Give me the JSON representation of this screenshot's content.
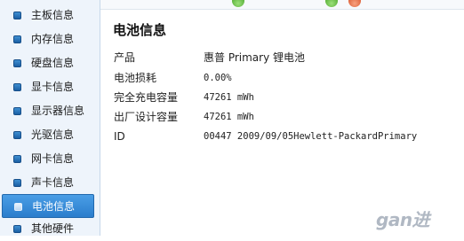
{
  "sidebar": {
    "items": [
      {
        "label": "主板信息"
      },
      {
        "label": "内存信息"
      },
      {
        "label": "硬盘信息"
      },
      {
        "label": "显卡信息"
      },
      {
        "label": "显示器信息"
      },
      {
        "label": "光驱信息"
      },
      {
        "label": "网卡信息"
      },
      {
        "label": "声卡信息"
      },
      {
        "label": "电池信息",
        "active": true
      },
      {
        "label": "其他硬件"
      }
    ]
  },
  "main": {
    "title": "电池信息",
    "rows": [
      {
        "label": "产品",
        "value": "惠普 Primary 锂电池"
      },
      {
        "label": "电池损耗",
        "value": "0.00%"
      },
      {
        "label": "完全充电容量",
        "value": "47261 mWh"
      },
      {
        "label": "出厂设计容量",
        "value": "47261 mWh"
      },
      {
        "label": "ID",
        "value": "00447 2009/09/05Hewlett-PackardPrimary"
      }
    ]
  },
  "status_dots": {
    "colors": [
      "#3c9a1c",
      "#3c9a1c",
      "#d2451b"
    ]
  },
  "watermark": {
    "text": "gan进"
  }
}
